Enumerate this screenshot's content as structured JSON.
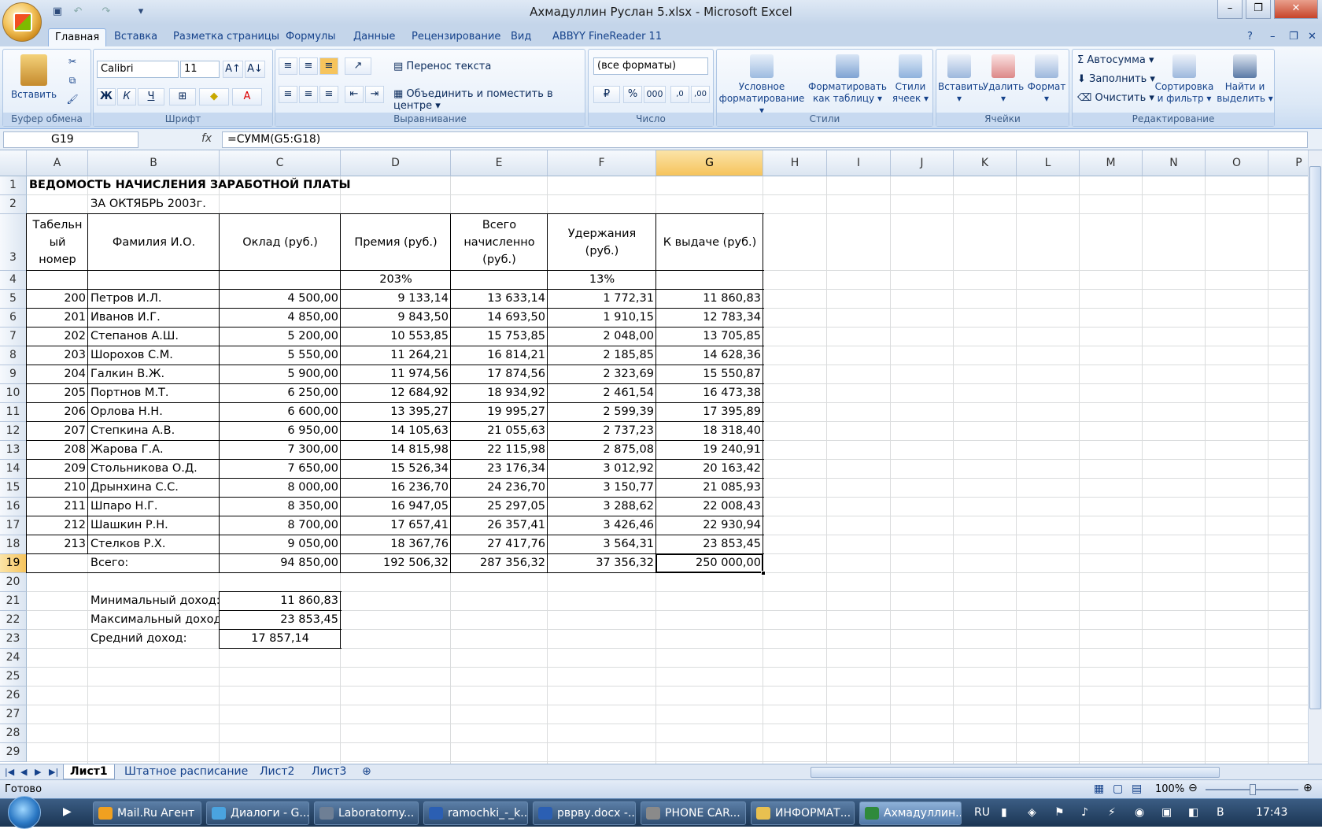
{
  "window": {
    "title": "Ахмадуллин Руслан 5.xlsx - Microsoft Excel"
  },
  "ribbon": {
    "tabs": [
      "Главная",
      "Вставка",
      "Разметка страницы",
      "Формулы",
      "Данные",
      "Рецензирование",
      "Вид",
      "ABBYY FineReader 11"
    ],
    "groups": {
      "clipboard": "Буфер обмена",
      "font": "Шрифт",
      "align": "Выравнивание",
      "number": "Число",
      "styles": "Стили",
      "cells": "Ячейки",
      "edit": "Редактирование"
    },
    "paste": "Вставить",
    "font_name": "Calibri",
    "font_size": "11",
    "bold": "Ж",
    "italic": "К",
    "underline": "Ч",
    "wrap": "Перенос текста",
    "merge": "Объединить и поместить в центре",
    "number_format": "(все форматы)",
    "percent": "%",
    "thousands": "000",
    "cond_format": [
      "Условное",
      "форматирование"
    ],
    "format_table": [
      "Форматировать",
      "как таблицу"
    ],
    "cell_styles": [
      "Стили",
      "ячеек"
    ],
    "insert": "Вставить",
    "delete": "Удалить",
    "format": "Формат",
    "autosum": "Автосумма",
    "fill": "Заполнить",
    "clear": "Очистить",
    "sort": [
      "Сортировка",
      "и фильтр"
    ],
    "find": [
      "Найти и",
      "выделить"
    ]
  },
  "formula_bar": {
    "name_box": "G19",
    "fx": "fx",
    "formula": "=СУММ(G5:G18)"
  },
  "columns": [
    "A",
    "B",
    "C",
    "D",
    "E",
    "F",
    "G",
    "H",
    "I",
    "J",
    "K",
    "L",
    "M",
    "N",
    "O",
    "P"
  ],
  "sheet": {
    "title": "ВЕДОМОСТЬ НАЧИСЛЕНИЯ ЗАРАБОТНОЙ ПЛАТЫ",
    "subtitle": "ЗА ОКТЯБРЬ 2003г.",
    "headers": [
      [
        "Табельн",
        "ый",
        "номер"
      ],
      [
        "Фамилия И.О."
      ],
      [
        "Оклад (руб.)"
      ],
      [
        "Премия (руб.)"
      ],
      [
        "Всего",
        "начисленно",
        "(руб.)"
      ],
      [
        "Удержания",
        "(руб.)"
      ],
      [
        "К выдаче (руб.)"
      ]
    ],
    "rates": {
      "bonus": "203%",
      "tax": "13%"
    },
    "rows": [
      [
        "200",
        "Петров И.Л.",
        "4 500,00",
        "9 133,14",
        "13 633,14",
        "1 772,31",
        "11 860,83"
      ],
      [
        "201",
        "Иванов И.Г.",
        "4 850,00",
        "9 843,50",
        "14 693,50",
        "1 910,15",
        "12 783,34"
      ],
      [
        "202",
        "Степанов А.Ш.",
        "5 200,00",
        "10 553,85",
        "15 753,85",
        "2 048,00",
        "13 705,85"
      ],
      [
        "203",
        "Шорохов С.М.",
        "5 550,00",
        "11 264,21",
        "16 814,21",
        "2 185,85",
        "14 628,36"
      ],
      [
        "204",
        "Галкин В.Ж.",
        "5 900,00",
        "11 974,56",
        "17 874,56",
        "2 323,69",
        "15 550,87"
      ],
      [
        "205",
        "Портнов М.Т.",
        "6 250,00",
        "12 684,92",
        "18 934,92",
        "2 461,54",
        "16 473,38"
      ],
      [
        "206",
        "Орлова Н.Н.",
        "6 600,00",
        "13 395,27",
        "19 995,27",
        "2 599,39",
        "17 395,89"
      ],
      [
        "207",
        "Степкина А.В.",
        "6 950,00",
        "14 105,63",
        "21 055,63",
        "2 737,23",
        "18 318,40"
      ],
      [
        "208",
        "Жарова Г.А.",
        "7 300,00",
        "14 815,98",
        "22 115,98",
        "2 875,08",
        "19 240,91"
      ],
      [
        "209",
        "Стольникова О.Д.",
        "7 650,00",
        "15 526,34",
        "23 176,34",
        "3 012,92",
        "20 163,42"
      ],
      [
        "210",
        "Дрынхина С.С.",
        "8 000,00",
        "16 236,70",
        "24 236,70",
        "3 150,77",
        "21 085,93"
      ],
      [
        "211",
        "Шпаро Н.Г.",
        "8 350,00",
        "16 947,05",
        "25 297,05",
        "3 288,62",
        "22 008,43"
      ],
      [
        "212",
        "Шашкин Р.Н.",
        "8 700,00",
        "17 657,41",
        "26 357,41",
        "3 426,46",
        "22 930,94"
      ],
      [
        "213",
        "Стелков Р.Х.",
        "9 050,00",
        "18 367,76",
        "27 417,76",
        "3 564,31",
        "23 853,45"
      ]
    ],
    "totals": {
      "label": "Всего:",
      "salary": "94 850,00",
      "bonus": "192 506,32",
      "total": "287 356,32",
      "tax": "37 356,32",
      "payout": "250 000,00"
    },
    "stats": [
      {
        "label": "Минимальный доход:",
        "value": "11 860,83"
      },
      {
        "label": "Максимальный доход:",
        "value": "23 853,45"
      },
      {
        "label": "Средний доход:",
        "value": "17 857,14"
      }
    ]
  },
  "sheet_tabs": [
    "Лист1",
    "Штатное расписание",
    "Лист2",
    "Лист3"
  ],
  "status": {
    "ready": "Готово",
    "zoom": "100%"
  },
  "taskbar": {
    "items": [
      "Mail.Ru Агент",
      "Диалоги - G...",
      "Laboratorny...",
      "ramochki_-_k...",
      "рврву.docx -...",
      "PHONE CAR...",
      "ИНФОРМАТ...",
      "Ахмадуллин..."
    ],
    "lang": "RU",
    "clock": "17:43"
  },
  "colors": {
    "accent": "#15428b",
    "selection": "#f6c45c"
  }
}
